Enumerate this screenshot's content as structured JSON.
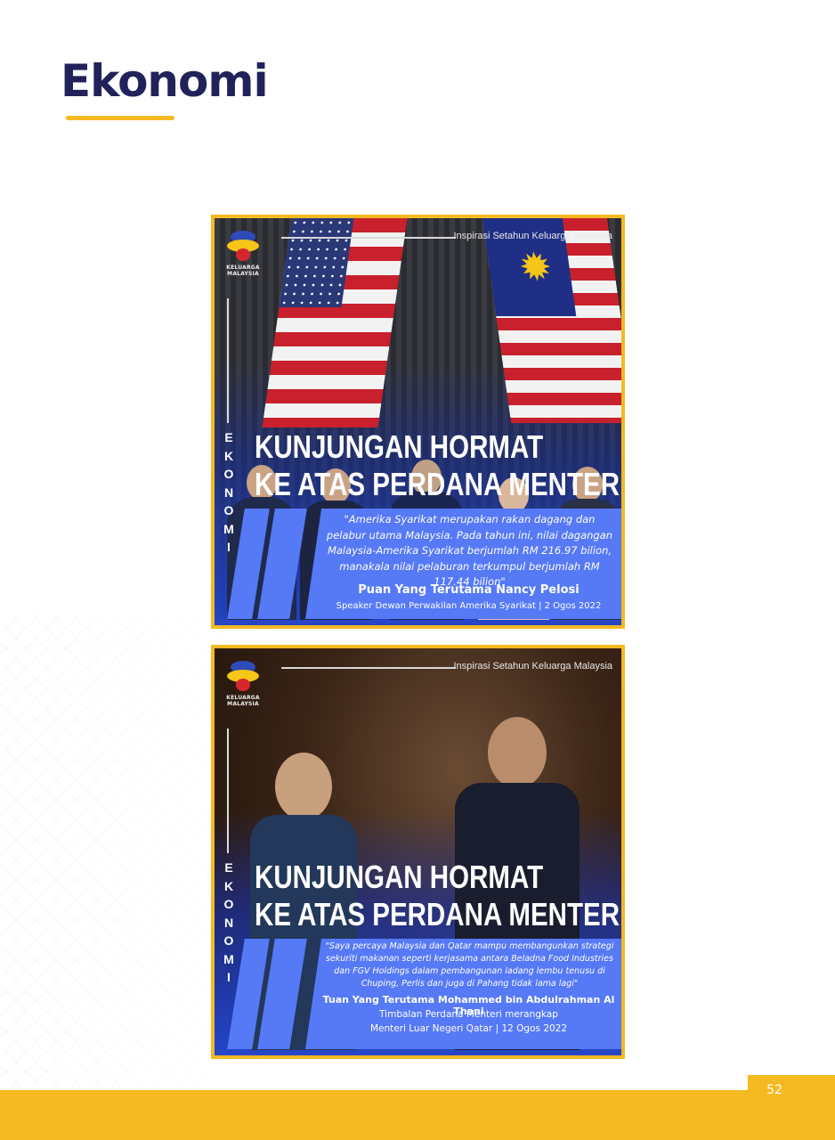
{
  "page": {
    "title": "Ekonomi",
    "page_number": "52",
    "accent_color": "#f5b921",
    "title_color": "#22225a"
  },
  "posters": [
    {
      "caption": "Inspirasi Setahun Keluarga Malaysia",
      "logo_text": "KELUARGA MALAYSIA",
      "side_text": "EKONOMI",
      "headline_line1": "KUNJUNGAN HORMAT",
      "headline_line2": "KE ATAS PERDANA MENTERI",
      "quote": "\"Amerika Syarikat merupakan rakan dagang dan pelabur utama Malaysia. Pada tahun ini, nilai dagangan Malaysia-Amerika Syarikat berjumlah RM 216.97 bilion, manakala nilai pelaburan terkumpul berjumlah RM 117.44 bilion\"",
      "speaker_name": "Puan Yang Terutama Nancy Pelosi",
      "speaker_role": "Speaker Dewan Perwakilan Amerika Syarikat | 2 Ogos 2022"
    },
    {
      "caption": "Inspirasi Setahun Keluarga Malaysia",
      "logo_text": "KELUARGA MALAYSIA",
      "side_text": "EKONOMI",
      "headline_line1": "KUNJUNGAN HORMAT",
      "headline_line2": "KE ATAS PERDANA MENTERI",
      "quote": "\"Saya percaya Malaysia dan Qatar mampu membangunkan strategi sekuriti makanan seperti kerjasama antara Beladna Food Industries dan FGV Holdings dalam pembangunan ladang lembu tenusu di Chuping, Perlis dan juga di Pahang tidak lama lagi\"",
      "speaker_name": "Tuan Yang Terutama Mohammed bin Abdulrahman Al Thani",
      "speaker_role_line1": "Timbalan Perdana Menteri merangkap",
      "speaker_role_line2": "Menteri Luar Negeri Qatar | 12 Ogos 2022"
    }
  ]
}
